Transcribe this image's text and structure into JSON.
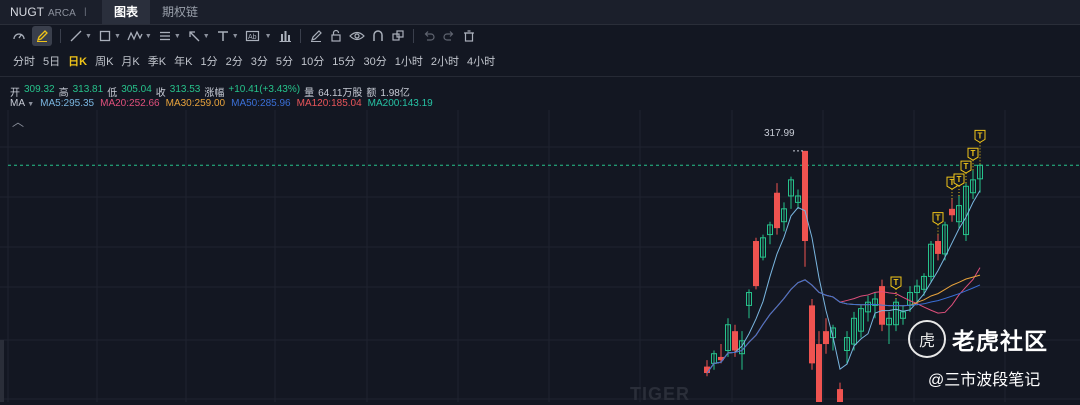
{
  "header": {
    "symbol": "NUGT",
    "exchange": "ARCA",
    "separator": "I",
    "tabs": [
      {
        "label": "图表",
        "active": true
      },
      {
        "label": "期权链",
        "active": false
      }
    ]
  },
  "toolbar": {
    "tools": [
      "speedometer-icon",
      "pencil-icon",
      "line-icon",
      "rectangle-icon",
      "wave-icon",
      "list-icon",
      "cursor-arrow-icon",
      "text-icon",
      "label-icon",
      "bar-chart-icon",
      "brush-icon",
      "lock-icon",
      "eye-icon",
      "magnet-icon",
      "layers-icon",
      "undo-icon",
      "redo-icon",
      "trash-icon"
    ]
  },
  "periods": [
    {
      "label": "分时",
      "active": false
    },
    {
      "label": "5日",
      "active": false
    },
    {
      "label": "日K",
      "active": true
    },
    {
      "label": "周K",
      "active": false
    },
    {
      "label": "月K",
      "active": false
    },
    {
      "label": "季K",
      "active": false
    },
    {
      "label": "年K",
      "active": false
    },
    {
      "label": "1分",
      "active": false
    },
    {
      "label": "2分",
      "active": false
    },
    {
      "label": "3分",
      "active": false
    },
    {
      "label": "5分",
      "active": false
    },
    {
      "label": "10分",
      "active": false
    },
    {
      "label": "15分",
      "active": false
    },
    {
      "label": "30分",
      "active": false
    },
    {
      "label": "1小时",
      "active": false
    },
    {
      "label": "2小时",
      "active": false
    },
    {
      "label": "4小时",
      "active": false
    }
  ],
  "ohlc": {
    "open_label": "开",
    "open": "309.32",
    "high_label": "高",
    "high": "313.81",
    "low_label": "低",
    "low": "305.04",
    "close_label": "收",
    "close": "313.53",
    "change_label": "涨幅",
    "change": "+10.41(+3.43%)",
    "volume_label": "量",
    "volume": "64.11万股",
    "amount_label": "额",
    "amount": "1.98亿"
  },
  "ma": {
    "label": "MA",
    "items": [
      {
        "text": "MA5:295.35",
        "color": "#7ab6e0"
      },
      {
        "text": "MA20:252.66",
        "color": "#e0507c"
      },
      {
        "text": "MA30:259.00",
        "color": "#e8a33c"
      },
      {
        "text": "MA50:285.96",
        "color": "#3a6fd6"
      },
      {
        "text": "MA120:185.04",
        "color": "#e8555a"
      },
      {
        "text": "MA200:143.19",
        "color": "#26c2a4"
      }
    ]
  },
  "price_marker": "317.99",
  "watermark": {
    "logo_glyph": "虎",
    "brand": "老虎社区",
    "handle": "@三市波段笔记",
    "faint": "TIGER"
  },
  "colors": {
    "background": "#131722",
    "up": "#26c28b",
    "down": "#ef5350",
    "accent": "#f0c419"
  },
  "chart_data": {
    "type": "candlestick",
    "title": "",
    "annotation_symbol": "T",
    "last_price_line": 313.53,
    "candles": [
      {
        "o": 251,
        "h": 253,
        "l": 248,
        "c": 249
      },
      {
        "o": 252,
        "h": 256,
        "l": 250,
        "c": 255
      },
      {
        "o": 254,
        "h": 258,
        "l": 252,
        "c": 253
      },
      {
        "o": 256,
        "h": 266,
        "l": 254,
        "c": 264
      },
      {
        "o": 262,
        "h": 264,
        "l": 254,
        "c": 256
      },
      {
        "o": 255,
        "h": 262,
        "l": 250,
        "c": 259
      },
      {
        "o": 270,
        "h": 275,
        "l": 266,
        "c": 274
      },
      {
        "o": 290,
        "h": 291,
        "l": 275,
        "c": 276
      },
      {
        "o": 285,
        "h": 292,
        "l": 284,
        "c": 291
      },
      {
        "o": 292,
        "h": 296,
        "l": 289,
        "c": 295
      },
      {
        "o": 305,
        "h": 308,
        "l": 292,
        "c": 294
      },
      {
        "o": 296,
        "h": 302,
        "l": 293,
        "c": 300
      },
      {
        "o": 304,
        "h": 310,
        "l": 300,
        "c": 309
      },
      {
        "o": 302,
        "h": 306,
        "l": 300,
        "c": 304
      },
      {
        "o": 318,
        "h": 318,
        "l": 282,
        "c": 290
      },
      {
        "o": 270,
        "h": 272,
        "l": 250,
        "c": 252
      },
      {
        "o": 258,
        "h": 262,
        "l": 236,
        "c": 238
      },
      {
        "o": 262,
        "h": 266,
        "l": 255,
        "c": 258
      },
      {
        "o": 260,
        "h": 264,
        "l": 256,
        "c": 263
      },
      {
        "o": 244,
        "h": 246,
        "l": 238,
        "c": 240
      },
      {
        "o": 256,
        "h": 262,
        "l": 252,
        "c": 260
      },
      {
        "o": 258,
        "h": 268,
        "l": 256,
        "c": 266
      },
      {
        "o": 262,
        "h": 270,
        "l": 260,
        "c": 269
      },
      {
        "o": 268,
        "h": 273,
        "l": 265,
        "c": 271
      },
      {
        "o": 270,
        "h": 274,
        "l": 266,
        "c": 272
      },
      {
        "o": 276,
        "h": 278,
        "l": 262,
        "c": 264
      },
      {
        "o": 264,
        "h": 268,
        "l": 258,
        "c": 266
      },
      {
        "o": 264,
        "h": 272,
        "l": 262,
        "c": 271
      },
      {
        "o": 266,
        "h": 270,
        "l": 264,
        "c": 268
      },
      {
        "o": 270,
        "h": 276,
        "l": 268,
        "c": 274
      },
      {
        "o": 274,
        "h": 278,
        "l": 270,
        "c": 276
      },
      {
        "o": 275,
        "h": 280,
        "l": 273,
        "c": 279
      },
      {
        "o": 279,
        "h": 290,
        "l": 277,
        "c": 289
      },
      {
        "o": 290,
        "h": 292,
        "l": 284,
        "c": 286
      },
      {
        "o": 286,
        "h": 296,
        "l": 284,
        "c": 295
      },
      {
        "o": 300,
        "h": 303,
        "l": 296,
        "c": 298
      },
      {
        "o": 296,
        "h": 304,
        "l": 294,
        "c": 301
      },
      {
        "o": 292,
        "h": 308,
        "l": 290,
        "c": 307
      },
      {
        "o": 305,
        "h": 312,
        "l": 303,
        "c": 309
      },
      {
        "o": 309.32,
        "h": 313.81,
        "l": 305.04,
        "c": 313.53
      }
    ]
  }
}
